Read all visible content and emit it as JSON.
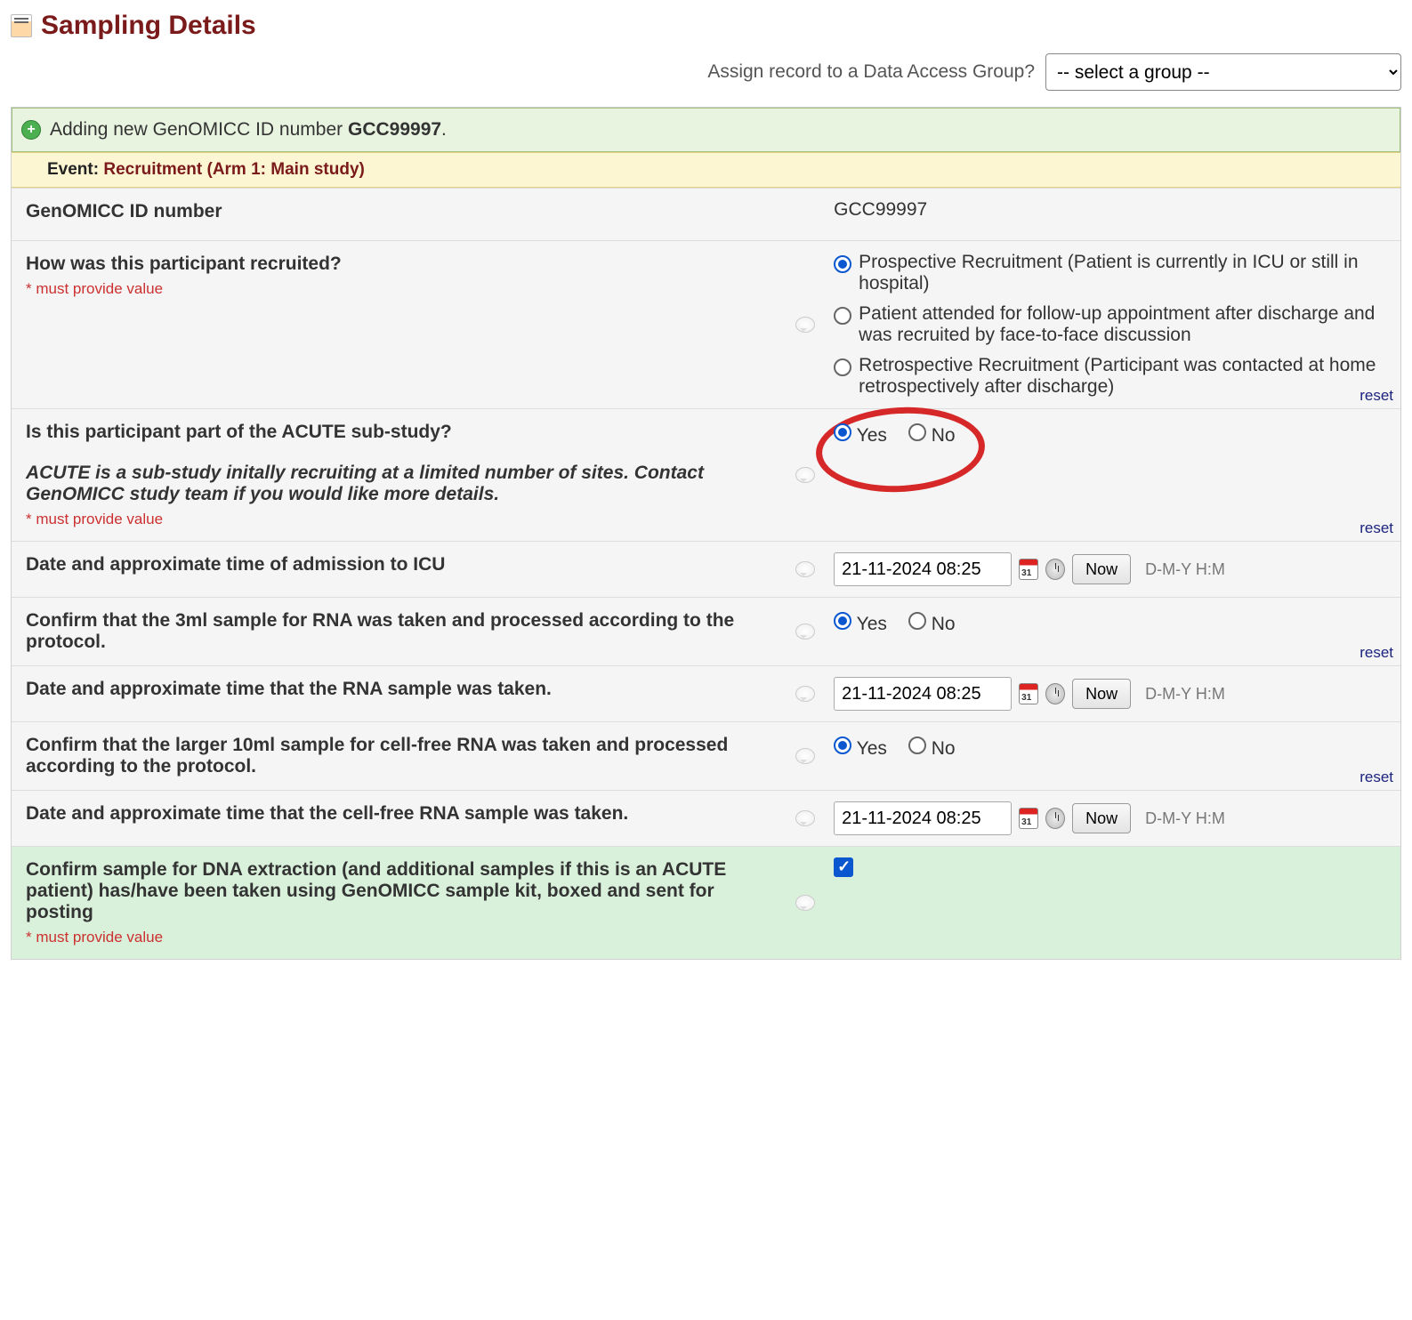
{
  "page_title": "Sampling Details",
  "dag": {
    "label": "Assign record to a Data Access Group?",
    "placeholder": "-- select a group --"
  },
  "add_banner": {
    "prefix": "Adding new GenOMICC ID number ",
    "id": "GCC99997",
    "suffix": "."
  },
  "event_banner": {
    "label": "Event:",
    "value": "Recruitment (Arm 1: Main study)"
  },
  "must": "* must provide value",
  "reset": "reset",
  "yes": "Yes",
  "no": "No",
  "now": "Now",
  "dmy": "D-M-Y H:M",
  "fields": {
    "id": {
      "label": "GenOMICC ID number",
      "value": "GCC99997"
    },
    "recruited": {
      "label": "How was this participant recruited?",
      "options": [
        "Prospective Recruitment (Patient is currently in ICU or still in hospital)",
        "Patient attended for follow-up appointment after discharge and was recruited by face-to-face discussion",
        "Retrospective Recruitment (Participant was contacted at home retrospectively after discharge)"
      ],
      "selected": 0
    },
    "acute": {
      "label": "Is this participant part of the ACUTE sub-study?",
      "note": "ACUTE is a sub-study initally recruiting at a limited number of sites. Contact GenOMICC study team if you would like more details.",
      "selected": 0
    },
    "icu_date": {
      "label": "Date and approximate time of admission to ICU",
      "value": "21-11-2024 08:25"
    },
    "rna3": {
      "label": "Confirm that the 3ml sample for RNA was taken and processed according to the protocol.",
      "selected": 0
    },
    "rna_date": {
      "label": "Date and approximate time that the RNA sample was taken.",
      "value": "21-11-2024 08:25"
    },
    "rna10": {
      "label": "Confirm that the larger 10ml sample for cell-free RNA was taken and processed according to the protocol.",
      "selected": 0
    },
    "cfdate": {
      "label": "Date and approximate time that the cell-free RNA sample was taken.",
      "value": "21-11-2024 08:25"
    },
    "dna": {
      "label": "Confirm sample for DNA extraction (and additional samples if this is an ACUTE patient) has/have been taken using GenOMICC sample kit, boxed and sent for posting",
      "checked": true
    }
  }
}
